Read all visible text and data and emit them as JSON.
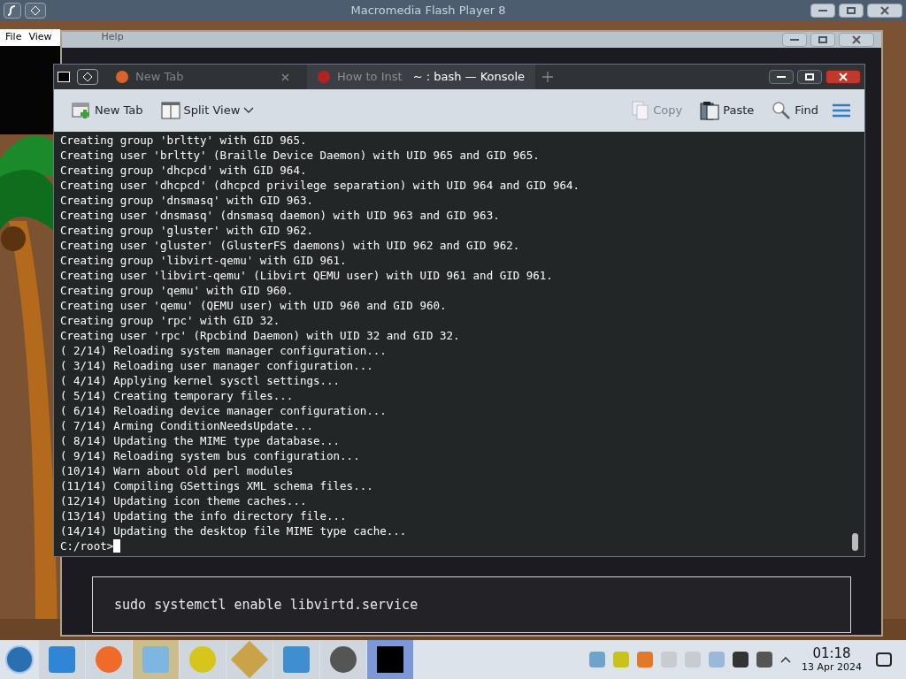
{
  "flash_window": {
    "title": "Macromedia Flash Player 8",
    "menu": [
      "File",
      "View",
      "Help"
    ]
  },
  "konsole": {
    "title": "~ : bash — Konsole",
    "browser_tabs": [
      {
        "label": "New Tab",
        "selected": false
      },
      {
        "label": "How to Inst",
        "selected": true
      }
    ],
    "toolbar": [
      {
        "kind": "new-tab",
        "label": "New Tab",
        "disabled": false
      },
      {
        "kind": "split",
        "label": "Split View",
        "disabled": false
      },
      {
        "kind": "copy",
        "label": "Copy",
        "disabled": true
      },
      {
        "kind": "paste",
        "label": "Paste",
        "disabled": false
      },
      {
        "kind": "find",
        "label": "Find",
        "disabled": false
      }
    ],
    "lines": [
      "Creating group 'brltty' with GID 965.",
      "Creating user 'brltty' (Braille Device Daemon) with UID 965 and GID 965.",
      "Creating group 'dhcpcd' with GID 964.",
      "Creating user 'dhcpcd' (dhcpcd privilege separation) with UID 964 and GID 964.",
      "Creating group 'dnsmasq' with GID 963.",
      "Creating user 'dnsmasq' (dnsmasq daemon) with UID 963 and GID 963.",
      "Creating group 'gluster' with GID 962.",
      "Creating user 'gluster' (GlusterFS daemons) with UID 962 and GID 962.",
      "Creating group 'libvirt-qemu' with GID 961.",
      "Creating user 'libvirt-qemu' (Libvirt QEMU user) with UID 961 and GID 961.",
      "Creating group 'qemu' with GID 960.",
      "Creating user 'qemu' (QEMU user) with UID 960 and GID 960.",
      "Creating group 'rpc' with GID 32.",
      "Creating user 'rpc' (Rpcbind Daemon) with UID 32 and GID 32.",
      "( 2/14) Reloading system manager configuration...",
      "( 3/14) Reloading user manager configuration...",
      "( 4/14) Applying kernel sysctl settings...",
      "( 5/14) Creating temporary files...",
      "( 6/14) Reloading device manager configuration...",
      "( 7/14) Arming ConditionNeedsUpdate...",
      "( 8/14) Updating the MIME type database...",
      "( 9/14) Reloading system bus configuration...",
      "(10/14) Warn about old perl modules",
      "(11/14) Compiling GSettings XML schema files...",
      "(12/14) Updating icon theme caches...",
      "(13/14) Updating the info directory file...",
      "(14/14) Updating the desktop file MIME type cache..."
    ],
    "prompt": "C:/root>"
  },
  "browser_content": {
    "code": "sudo systemctl enable libvirtd.service"
  },
  "taskbar": {
    "time": "01:18",
    "date": "13 Apr 2024"
  }
}
